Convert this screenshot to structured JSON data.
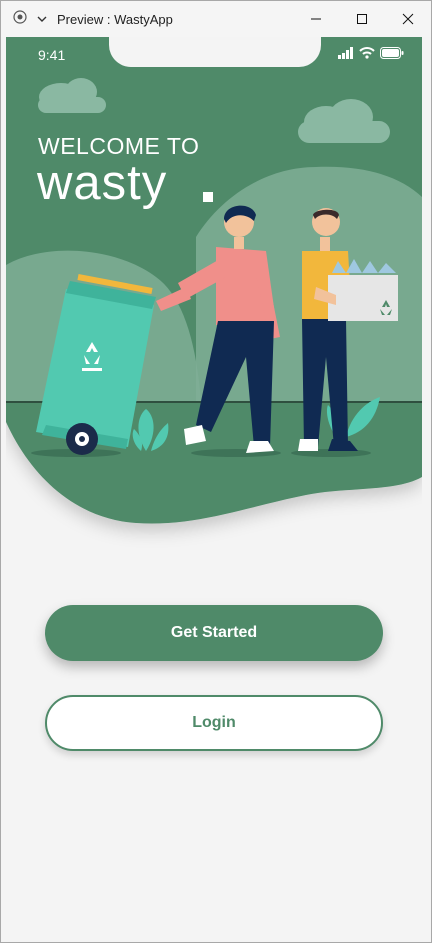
{
  "window": {
    "title": "Preview : WastyApp",
    "controls": [
      "minimize-icon",
      "maximize-icon",
      "close-icon"
    ]
  },
  "statusbar": {
    "time": "9:41",
    "icons": [
      "signal-icon",
      "wifi-icon",
      "battery-icon"
    ]
  },
  "hero": {
    "welcome": "WELCOME TO",
    "brand": "wasty",
    "colors": {
      "primary": "#4f8a69",
      "light": "#7fae97",
      "bin": "#52c9b0"
    }
  },
  "actions": {
    "get_started_label": "Get Started",
    "login_label": "Login"
  }
}
